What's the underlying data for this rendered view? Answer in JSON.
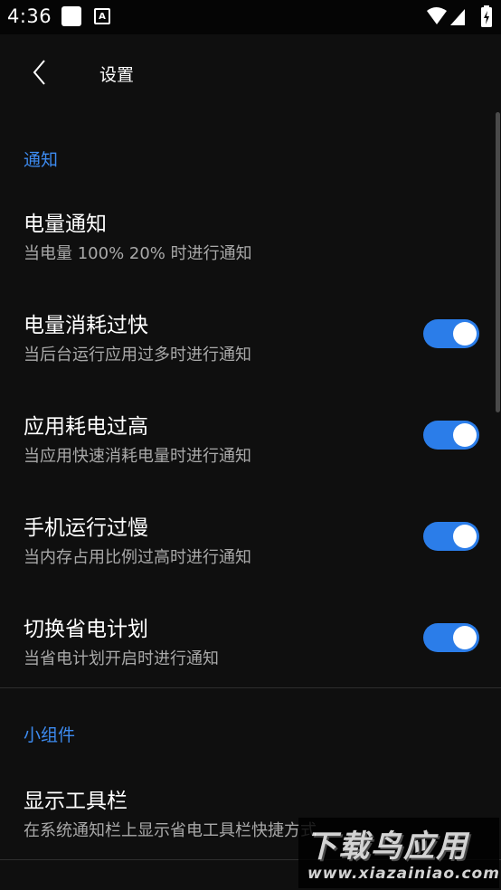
{
  "status_bar": {
    "time": "4:36",
    "notification_letter": "A"
  },
  "toolbar": {
    "title": "设置"
  },
  "sections": {
    "notifications": {
      "header": "通知",
      "items": [
        {
          "title": "电量通知",
          "subtitle": "当电量 100% 20% 时进行通知"
        },
        {
          "title": "电量消耗过快",
          "subtitle": "当后台运行应用过多时进行通知",
          "enabled": true
        },
        {
          "title": "应用耗电过高",
          "subtitle": "当应用快速消耗电量时进行通知",
          "enabled": true
        },
        {
          "title": "手机运行过慢",
          "subtitle": "当内存占用比例过高时进行通知",
          "enabled": true
        },
        {
          "title": "切换省电计划",
          "subtitle": "当省电计划开启时进行通知",
          "enabled": true
        }
      ]
    },
    "widgets": {
      "header": "小组件",
      "items": [
        {
          "title": "显示工具栏",
          "subtitle": "在系统通知栏上显示省电工具栏快捷方式"
        }
      ]
    }
  },
  "watermark": {
    "main": "下载鸟应用",
    "url": "www.xiazainiao.com"
  },
  "colors": {
    "accent": "#3d8bf0",
    "switch_on": "#2b7de9",
    "background": "#0f0f0f"
  }
}
